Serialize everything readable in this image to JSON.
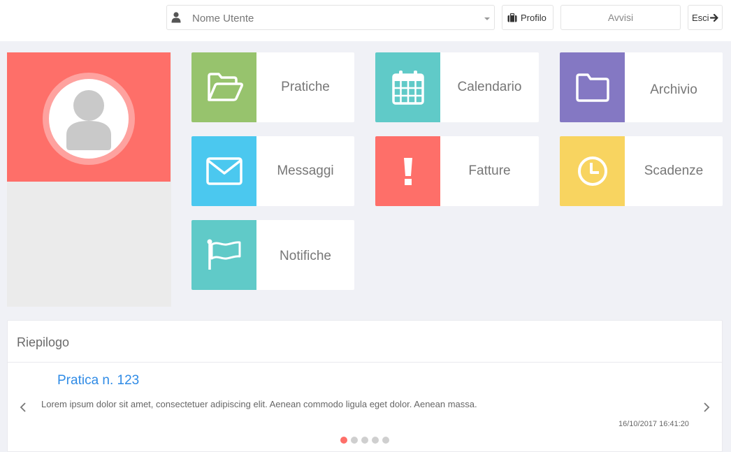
{
  "topbar": {
    "user_placeholder": "Nome Utente",
    "profile_label": "Profilo",
    "notices_label": "Avvisi",
    "logout_label": "Esci"
  },
  "tiles": [
    {
      "key": "pratiche",
      "label": "Pratiche",
      "color": "#97c36d",
      "icon": "folder-open-icon"
    },
    {
      "key": "calendario",
      "label": "Calendario",
      "color": "#60cac8",
      "icon": "calendar-icon"
    },
    {
      "key": "archivio",
      "label": "Archivio",
      "color": "#8478c3",
      "icon": "folder-icon"
    },
    {
      "key": "messaggi",
      "label": "Messaggi",
      "color": "#4bc8ef",
      "icon": "envelope-icon"
    },
    {
      "key": "fatture",
      "label": "Fatture",
      "color": "#fe6f69",
      "icon": "exclamation-icon"
    },
    {
      "key": "scadenze",
      "label": "Scadenze",
      "color": "#f8d460",
      "icon": "clock-icon"
    },
    {
      "key": "notifiche",
      "label": "Notifiche",
      "color": "#60cac8",
      "icon": "flag-icon"
    }
  ],
  "profile": {
    "header_color": "#fe6f69",
    "avatar": "user-avatar-icon"
  },
  "summary": {
    "title": "Riepilogo",
    "item_title": "Pratica n. 123",
    "item_text": "Lorem ipsum dolor sit amet, consectetuer adipiscing elit. Aenean commodo ligula eget dolor. Aenean massa.",
    "item_date": "16/10/2017 16:41:20",
    "slides_total": 5,
    "active_slide": 1
  }
}
